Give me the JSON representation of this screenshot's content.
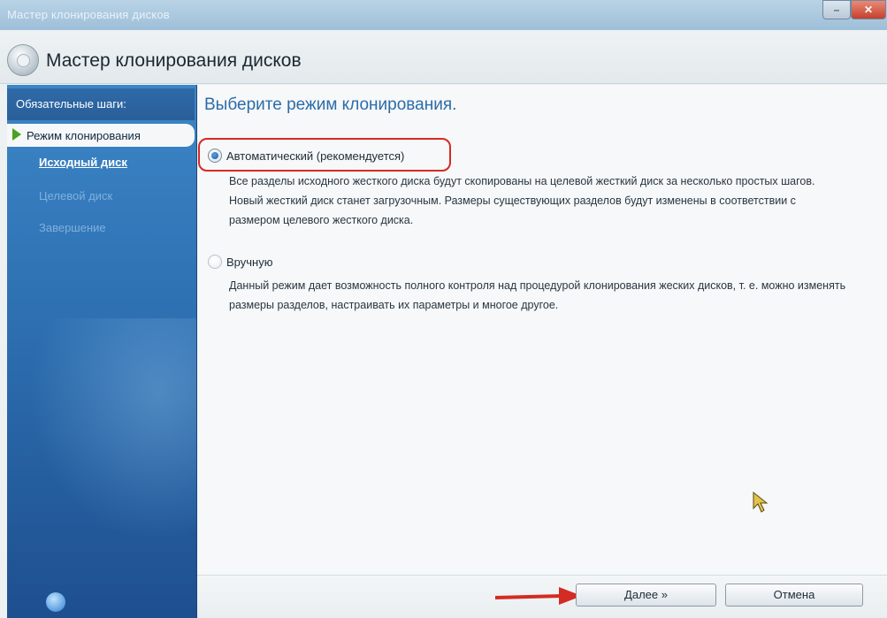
{
  "window": {
    "titlebar_text": "Мастер клонирования дисков",
    "header_title": "Мастер клонирования дисков"
  },
  "sidebar": {
    "heading": "Обязательные шаги:",
    "items": [
      {
        "label": "Режим клонирования",
        "state": "current"
      },
      {
        "label": "Исходный диск",
        "state": "next"
      },
      {
        "label": "Целевой диск",
        "state": "disabled"
      },
      {
        "label": "Завершение",
        "state": "disabled"
      }
    ]
  },
  "main": {
    "title": "Выберите режим клонирования.",
    "options": [
      {
        "label": "Автоматический (рекомендуется)",
        "selected": true,
        "description": "Все разделы исходного жесткого диска будут скопированы на целевой жесткий диск за несколько простых шагов. Новый жесткий диск станет загрузочным. Размеры существующих разделов будут изменены в соответствии с размером целевого жесткого диска."
      },
      {
        "label": "Вручную",
        "selected": false,
        "description": "Данный режим дает возможность полного контроля над процедурой клонирования жеских дисков, т. е. можно изменять размеры разделов, настраивать их параметры и многое другое."
      }
    ]
  },
  "footer": {
    "next_label": "Далее »",
    "cancel_label": "Отмена"
  },
  "colors": {
    "accent": "#2c6ca9",
    "highlight_ring": "#d42b22",
    "sidebar": "#2d6fb1"
  }
}
